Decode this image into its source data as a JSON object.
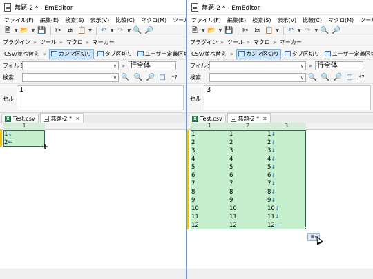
{
  "windows": [
    {
      "id": "left",
      "title": "無題-2 * - EmEditor",
      "menu": [
        "ファイル(F)",
        "編集(E)",
        "検索(S)",
        "表示(V)",
        "比較(C)",
        "マクロ(M)",
        "ツール(T)"
      ],
      "bar2": [
        "プラグイン",
        "ツール",
        "マクロ",
        "マーカー"
      ],
      "csv_buttons": [
        "CSV/並べ替え",
        "カンマ区切り",
        "タブ区切り",
        "ユーザー定義区切り"
      ],
      "filter_label": "フィルター",
      "filter_scope": "行全体",
      "search_label": "検索",
      "regex_label": ".*?",
      "cell_label": "セル",
      "cell_value": "1",
      "tabs": [
        "Test.csv",
        "無題-2 *"
      ],
      "columns": [
        "1"
      ],
      "rows": [
        [
          "1",
          "↓"
        ],
        [
          "2",
          "←"
        ]
      ]
    },
    {
      "id": "right",
      "title": "無題-2 * - EmEditor",
      "menu": [
        "ファイル(F)",
        "編集(E)",
        "検索(S)",
        "表示(V)",
        "比較(C)",
        "マクロ(M)",
        "ツール(T)"
      ],
      "bar2": [
        "プラグイン",
        "ツール",
        "マクロ",
        "マーカー"
      ],
      "csv_buttons": [
        "CSV/並べ替え",
        "カンマ区切り",
        "タブ区切り",
        "ユーザー定義区切り"
      ],
      "filter_label": "フィルター",
      "filter_scope": "行全体",
      "search_label": "検索",
      "regex_label": ".*?",
      "cell_label": "セル",
      "cell_value": "3",
      "tabs": [
        "Test.csv",
        "無題-2 *"
      ],
      "columns": [
        "1",
        "2",
        "3"
      ],
      "rows": [
        [
          "1",
          "1",
          "1",
          "↓"
        ],
        [
          "2",
          "2",
          "2",
          "↓"
        ],
        [
          "3",
          "3",
          "3",
          "↓"
        ],
        [
          "4",
          "4",
          "4",
          "↓"
        ],
        [
          "5",
          "5",
          "5",
          "↓"
        ],
        [
          "6",
          "6",
          "6",
          "↓"
        ],
        [
          "7",
          "7",
          "7",
          "↓"
        ],
        [
          "8",
          "8",
          "8",
          "↓"
        ],
        [
          "9",
          "9",
          "9",
          "↓"
        ],
        [
          "10",
          "10",
          "10",
          "↓"
        ],
        [
          "11",
          "11",
          "11",
          "↓"
        ],
        [
          "12",
          "12",
          "12",
          "←"
        ]
      ]
    }
  ],
  "icons": [
    "new-file-icon",
    "open-folder-icon",
    "save-icon",
    "cut-icon",
    "copy-icon",
    "paste-icon",
    "undo-icon",
    "redo-icon",
    "find-icon",
    "replace-icon",
    "close-icon",
    "csv-grid-icon",
    "excel-file-icon",
    "document-icon",
    "fill-handle-icon",
    "smart-tag-icon",
    "mouse-cursor-icon"
  ],
  "colors": {
    "selection": "#c6efce",
    "selection_border": "#1e7145",
    "line_marker": "#f2c200",
    "newline_arrow": "#1f6fd1",
    "divider": "#6a9ad6"
  }
}
